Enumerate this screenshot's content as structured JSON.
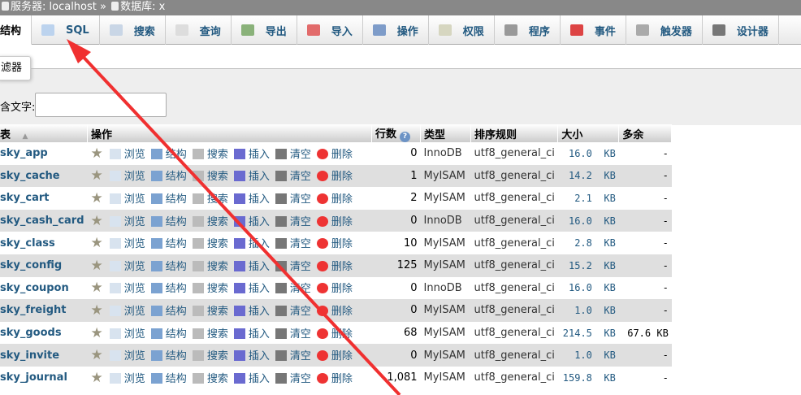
{
  "breadcrumb": {
    "server_label": "服务器: localhost",
    "separator": "»",
    "db_label": "数据库: x"
  },
  "tabs": [
    {
      "label": "结构",
      "icon": "structure-icon",
      "active": true
    },
    {
      "label": "SQL",
      "icon": "sql-icon"
    },
    {
      "label": "搜索",
      "icon": "search-icon"
    },
    {
      "label": "查询",
      "icon": "query-icon"
    },
    {
      "label": "导出",
      "icon": "export-icon"
    },
    {
      "label": "导入",
      "icon": "import-icon"
    },
    {
      "label": "操作",
      "icon": "wrench-icon"
    },
    {
      "label": "权限",
      "icon": "privileges-icon"
    },
    {
      "label": "程序",
      "icon": "routines-icon"
    },
    {
      "label": "事件",
      "icon": "events-icon"
    },
    {
      "label": "触发器",
      "icon": "triggers-icon"
    },
    {
      "label": "设计器",
      "icon": "designer-icon"
    }
  ],
  "filter": {
    "button": "滤器",
    "label": "含文字:",
    "value": ""
  },
  "table": {
    "headers": {
      "name": "表",
      "ops": "操作",
      "rows": "行数",
      "type": "类型",
      "collation": "排序规则",
      "size": "大小",
      "overhead": "多余"
    },
    "op_labels": {
      "browse": "浏览",
      "structure": "结构",
      "search": "搜索",
      "insert": "插入",
      "empty": "清空",
      "drop": "删除"
    },
    "rows": [
      {
        "name": "sky_app",
        "rows": "0",
        "type": "InnoDB",
        "collation": "utf8_general_ci",
        "size": "16.0",
        "unit": "KB",
        "overhead": "-"
      },
      {
        "name": "sky_cache",
        "rows": "1",
        "type": "MyISAM",
        "collation": "utf8_general_ci",
        "size": "14.2",
        "unit": "KB",
        "overhead": "-"
      },
      {
        "name": "sky_cart",
        "rows": "2",
        "type": "MyISAM",
        "collation": "utf8_general_ci",
        "size": "2.1",
        "unit": "KB",
        "overhead": "-"
      },
      {
        "name": "sky_cash_card",
        "rows": "0",
        "type": "InnoDB",
        "collation": "utf8_general_ci",
        "size": "16.0",
        "unit": "KB",
        "overhead": "-"
      },
      {
        "name": "sky_class",
        "rows": "10",
        "type": "MyISAM",
        "collation": "utf8_general_ci",
        "size": "2.8",
        "unit": "KB",
        "overhead": "-"
      },
      {
        "name": "sky_config",
        "rows": "125",
        "type": "MyISAM",
        "collation": "utf8_general_ci",
        "size": "15.2",
        "unit": "KB",
        "overhead": "-"
      },
      {
        "name": "sky_coupon",
        "rows": "0",
        "type": "InnoDB",
        "collation": "utf8_general_ci",
        "size": "16.0",
        "unit": "KB",
        "overhead": "-"
      },
      {
        "name": "sky_freight",
        "rows": "0",
        "type": "MyISAM",
        "collation": "utf8_general_ci",
        "size": "1.0",
        "unit": "KB",
        "overhead": "-"
      },
      {
        "name": "sky_goods",
        "rows": "68",
        "type": "MyISAM",
        "collation": "utf8_general_ci",
        "size": "214.5",
        "unit": "KB",
        "overhead": "67.6 KB"
      },
      {
        "name": "sky_invite",
        "rows": "0",
        "type": "MyISAM",
        "collation": "utf8_general_ci",
        "size": "1.0",
        "unit": "KB",
        "overhead": "-"
      },
      {
        "name": "sky_journal",
        "rows": "1,081",
        "type": "MyISAM",
        "collation": "utf8_general_ci",
        "size": "159.8",
        "unit": "KB",
        "overhead": "-"
      }
    ]
  },
  "annotation_color": "#f03030"
}
